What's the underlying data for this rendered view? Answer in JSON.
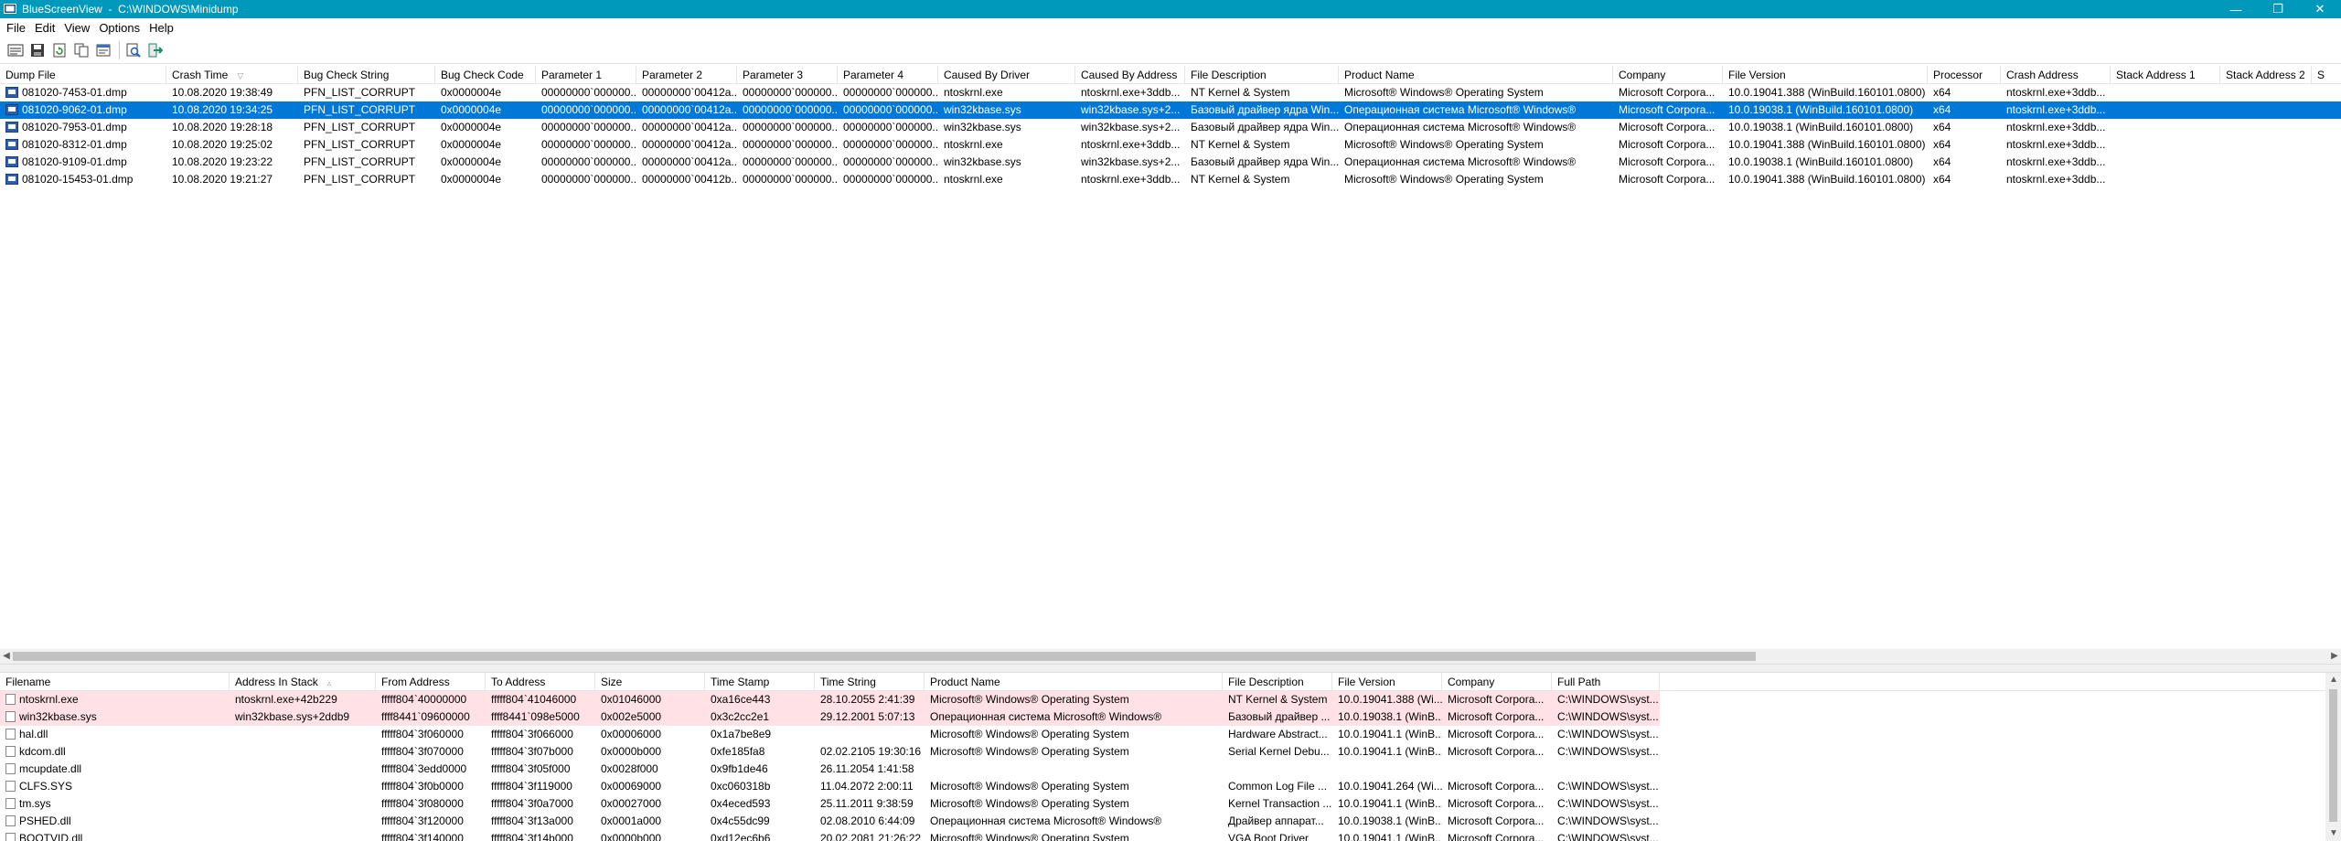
{
  "window": {
    "title": "BlueScreenView  -  C:\\WINDOWS\\Minidump",
    "minimize": "—",
    "maximize": "❐",
    "close": "✕"
  },
  "menu": [
    "File",
    "Edit",
    "View",
    "Options",
    "Help"
  ],
  "toolbar": [
    "save-report",
    "save-selected",
    "refresh",
    "copy",
    "properties",
    "find",
    "exit"
  ],
  "upper": {
    "columns": [
      {
        "label": "Dump File",
        "w": 182
      },
      {
        "label": "Crash Time",
        "w": 144,
        "sort": "▽"
      },
      {
        "label": "Bug Check String",
        "w": 150
      },
      {
        "label": "Bug Check Code",
        "w": 110
      },
      {
        "label": "Parameter 1",
        "w": 110
      },
      {
        "label": "Parameter 2",
        "w": 110
      },
      {
        "label": "Parameter 3",
        "w": 110
      },
      {
        "label": "Parameter 4",
        "w": 110
      },
      {
        "label": "Caused By Driver",
        "w": 150
      },
      {
        "label": "Caused By Address",
        "w": 120
      },
      {
        "label": "File Description",
        "w": 168
      },
      {
        "label": "Product Name",
        "w": 300
      },
      {
        "label": "Company",
        "w": 120
      },
      {
        "label": "File Version",
        "w": 224
      },
      {
        "label": "Processor",
        "w": 80
      },
      {
        "label": "Crash Address",
        "w": 120
      },
      {
        "label": "Stack Address 1",
        "w": 120
      },
      {
        "label": "Stack Address 2",
        "w": 100
      },
      {
        "label": "S",
        "w": 40
      }
    ],
    "rows": [
      [
        "081020-7453-01.dmp",
        "10.08.2020 19:38:49",
        "PFN_LIST_CORRUPT",
        "0x0000004e",
        "00000000`000000...",
        "00000000`00412a...",
        "00000000`000000...",
        "00000000`000000...",
        "ntoskrnl.exe",
        "ntoskrnl.exe+3ddb...",
        "NT Kernel & System",
        "Microsoft® Windows® Operating System",
        "Microsoft Corpora...",
        "10.0.19041.388 (WinBuild.160101.0800)",
        "x64",
        "ntoskrnl.exe+3ddb...",
        "",
        "",
        ""
      ],
      [
        "081020-9062-01.dmp",
        "10.08.2020 19:34:25",
        "PFN_LIST_CORRUPT",
        "0x0000004e",
        "00000000`000000...",
        "00000000`00412a...",
        "00000000`000000...",
        "00000000`000000...",
        "win32kbase.sys",
        "win32kbase.sys+2...",
        "Базовый драйвер ядра Win...",
        "Операционная система Microsoft® Windows®",
        "Microsoft Corpora...",
        "10.0.19038.1 (WinBuild.160101.0800)",
        "x64",
        "ntoskrnl.exe+3ddb...",
        "",
        "",
        ""
      ],
      [
        "081020-7953-01.dmp",
        "10.08.2020 19:28:18",
        "PFN_LIST_CORRUPT",
        "0x0000004e",
        "00000000`000000...",
        "00000000`00412a...",
        "00000000`000000...",
        "00000000`000000...",
        "win32kbase.sys",
        "win32kbase.sys+2...",
        "Базовый драйвер ядра Win...",
        "Операционная система Microsoft® Windows®",
        "Microsoft Corpora...",
        "10.0.19038.1 (WinBuild.160101.0800)",
        "x64",
        "ntoskrnl.exe+3ddb...",
        "",
        "",
        ""
      ],
      [
        "081020-8312-01.dmp",
        "10.08.2020 19:25:02",
        "PFN_LIST_CORRUPT",
        "0x0000004e",
        "00000000`000000...",
        "00000000`00412a...",
        "00000000`000000...",
        "00000000`000000...",
        "ntoskrnl.exe",
        "ntoskrnl.exe+3ddb...",
        "NT Kernel & System",
        "Microsoft® Windows® Operating System",
        "Microsoft Corpora...",
        "10.0.19041.388 (WinBuild.160101.0800)",
        "x64",
        "ntoskrnl.exe+3ddb...",
        "",
        "",
        ""
      ],
      [
        "081020-9109-01.dmp",
        "10.08.2020 19:23:22",
        "PFN_LIST_CORRUPT",
        "0x0000004e",
        "00000000`000000...",
        "00000000`00412a...",
        "00000000`000000...",
        "00000000`000000...",
        "win32kbase.sys",
        "win32kbase.sys+2...",
        "Базовый драйвер ядра Win...",
        "Операционная система Microsoft® Windows®",
        "Microsoft Corpora...",
        "10.0.19038.1 (WinBuild.160101.0800)",
        "x64",
        "ntoskrnl.exe+3ddb...",
        "",
        "",
        ""
      ],
      [
        "081020-15453-01.dmp",
        "10.08.2020 19:21:27",
        "PFN_LIST_CORRUPT",
        "0x0000004e",
        "00000000`000000...",
        "00000000`00412b...",
        "00000000`000000...",
        "00000000`000000...",
        "ntoskrnl.exe",
        "ntoskrnl.exe+3ddb...",
        "NT Kernel & System",
        "Microsoft® Windows® Operating System",
        "Microsoft Corpora...",
        "10.0.19041.388 (WinBuild.160101.0800)",
        "x64",
        "ntoskrnl.exe+3ddb...",
        "",
        "",
        ""
      ]
    ],
    "selected_row": 1
  },
  "lower": {
    "columns": [
      {
        "label": "Filename",
        "w": 251
      },
      {
        "label": "Address In Stack",
        "w": 160,
        "sort": "▵"
      },
      {
        "label": "From Address",
        "w": 120
      },
      {
        "label": "To Address",
        "w": 120
      },
      {
        "label": "Size",
        "w": 120
      },
      {
        "label": "Time Stamp",
        "w": 120
      },
      {
        "label": "Time String",
        "w": 120
      },
      {
        "label": "Product Name",
        "w": 326
      },
      {
        "label": "File Description",
        "w": 120
      },
      {
        "label": "File Version",
        "w": 120
      },
      {
        "label": "Company",
        "w": 120
      },
      {
        "label": "Full Path",
        "w": 118
      }
    ],
    "rows": [
      {
        "pink": true,
        "cells": [
          "ntoskrnl.exe",
          "ntoskrnl.exe+42b229",
          "fffff804`40000000",
          "fffff804`41046000",
          "0x01046000",
          "0xa16ce443",
          "28.10.2055 2:41:39",
          "Microsoft® Windows® Operating System",
          "NT Kernel & System",
          "10.0.19041.388 (Wi...",
          "Microsoft Corpora...",
          "C:\\WINDOWS\\syst..."
        ]
      },
      {
        "pink": true,
        "cells": [
          "win32kbase.sys",
          "win32kbase.sys+2ddb9",
          "ffff8441`09600000",
          "ffff8441`098e5000",
          "0x002e5000",
          "0x3c2cc2e1",
          "29.12.2001 5:07:13",
          "Операционная система Microsoft® Windows®",
          "Базовый драйвер ...",
          "10.0.19038.1 (WinB...",
          "Microsoft Corpora...",
          "C:\\WINDOWS\\syst..."
        ]
      },
      {
        "pink": false,
        "cells": [
          "hal.dll",
          "",
          "fffff804`3f060000",
          "fffff804`3f066000",
          "0x00006000",
          "0x1a7be8e9",
          "",
          "Microsoft® Windows® Operating System",
          "Hardware Abstract...",
          "10.0.19041.1 (WinB...",
          "Microsoft Corpora...",
          "C:\\WINDOWS\\syst..."
        ]
      },
      {
        "pink": false,
        "cells": [
          "kdcom.dll",
          "",
          "fffff804`3f070000",
          "fffff804`3f07b000",
          "0x0000b000",
          "0xfe185fa8",
          "02.02.2105 19:30:16",
          "Microsoft® Windows® Operating System",
          "Serial Kernel Debu...",
          "10.0.19041.1 (WinB...",
          "Microsoft Corpora...",
          "C:\\WINDOWS\\syst..."
        ]
      },
      {
        "pink": false,
        "cells": [
          "mcupdate.dll",
          "",
          "fffff804`3edd0000",
          "fffff804`3f05f000",
          "0x0028f000",
          "0x9fb1de46",
          "26.11.2054 1:41:58",
          "",
          "",
          "",
          "",
          ""
        ]
      },
      {
        "pink": false,
        "cells": [
          "CLFS.SYS",
          "",
          "fffff804`3f0b0000",
          "fffff804`3f119000",
          "0x00069000",
          "0xc060318b",
          "11.04.2072 2:00:11",
          "Microsoft® Windows® Operating System",
          "Common Log File ...",
          "10.0.19041.264 (Wi...",
          "Microsoft Corpora...",
          "C:\\WINDOWS\\syst..."
        ]
      },
      {
        "pink": false,
        "cells": [
          "tm.sys",
          "",
          "fffff804`3f080000",
          "fffff804`3f0a7000",
          "0x00027000",
          "0x4eced593",
          "25.11.2011 9:38:59",
          "Microsoft® Windows® Operating System",
          "Kernel Transaction ...",
          "10.0.19041.1 (WinB...",
          "Microsoft Corpora...",
          "C:\\WINDOWS\\syst..."
        ]
      },
      {
        "pink": false,
        "cells": [
          "PSHED.dll",
          "",
          "fffff804`3f120000",
          "fffff804`3f13a000",
          "0x0001a000",
          "0x4c55dc99",
          "02.08.2010 6:44:09",
          "Операционная система Microsoft® Windows®",
          "Драйвер аппарат...",
          "10.0.19038.1 (WinB...",
          "Microsoft Corpora...",
          "C:\\WINDOWS\\syst..."
        ]
      },
      {
        "pink": false,
        "cells": [
          "BOOTVID.dll",
          "",
          "fffff804`3f140000",
          "fffff804`3f14b000",
          "0x0000b000",
          "0xd12ec6b6",
          "20.02.2081 21:26:22",
          "Microsoft® Windows® Operating System",
          "VGA Boot Driver",
          "10.0.19041.1 (WinB...",
          "Microsoft Corpora...",
          "C:\\WINDOWS\\syst..."
        ]
      }
    ]
  },
  "scroll": {
    "left_arrow": "◀",
    "right_arrow": "▶",
    "up_arrow": "▲",
    "down_arrow": "▼"
  }
}
